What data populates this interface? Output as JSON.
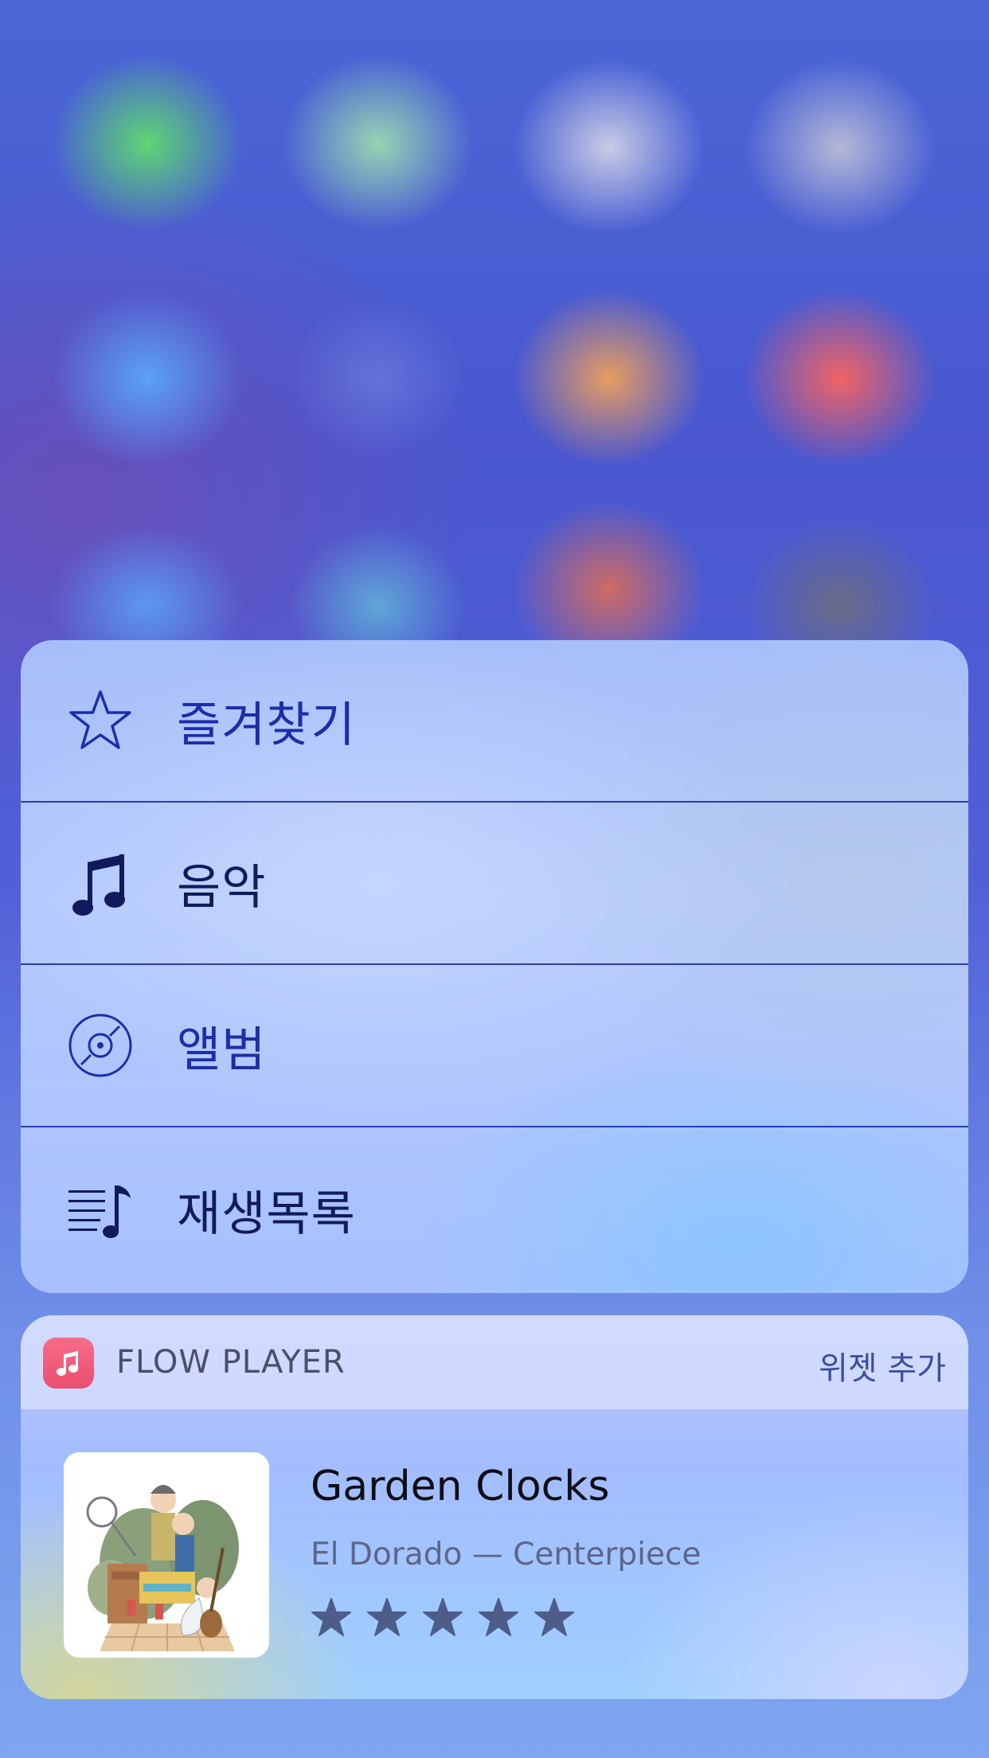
{
  "quick_actions": {
    "items": [
      {
        "label": "즐겨찾기",
        "icon": "star-outline-icon"
      },
      {
        "label": "음악",
        "icon": "music-note-icon"
      },
      {
        "label": "앨범",
        "icon": "album-disc-icon"
      },
      {
        "label": "재생목록",
        "icon": "playlist-icon"
      }
    ]
  },
  "widget": {
    "app_name": "FLOW PLAYER",
    "app_icon": "music-note-icon",
    "add_widget_label": "위젯 추가",
    "now_playing": {
      "title": "Garden Clocks",
      "subtitle": "El Dorado — Centerpiece",
      "rating": 5,
      "rating_max": 5
    }
  },
  "colors": {
    "accent": "#1c2ea8",
    "app_icon": "#ea4e6f",
    "star": "#4d5c88"
  }
}
